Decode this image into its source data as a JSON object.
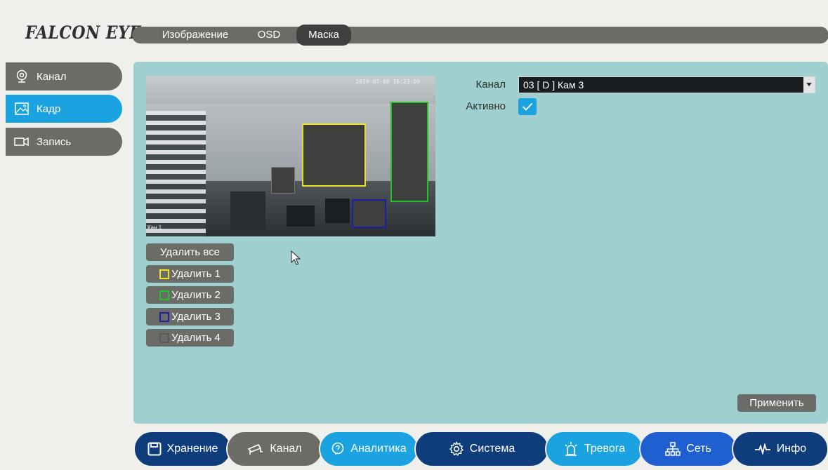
{
  "brand": {
    "logo": "FALCON EYE"
  },
  "tabs": [
    {
      "label": "Изображение",
      "active": false
    },
    {
      "label": "OSD",
      "active": false
    },
    {
      "label": "Маска",
      "active": true
    }
  ],
  "sidebar": {
    "items": [
      {
        "label": "Канал",
        "icon": "webcam-icon",
        "active": false
      },
      {
        "label": "Кадр",
        "icon": "image-icon",
        "active": true
      },
      {
        "label": "Запись",
        "icon": "video-camera-icon",
        "active": false
      }
    ]
  },
  "preview": {
    "timestamp": "2019-07-08 16:23:09",
    "camera_label": "Кан 1",
    "masks": [
      {
        "id": 1,
        "color": "#e8e22a"
      },
      {
        "id": 2,
        "color": "#22c22a"
      },
      {
        "id": 3,
        "color": "#1a1fa8"
      }
    ]
  },
  "delete": {
    "all_label": "Удалить все",
    "buttons": [
      {
        "label": "Удалить 1",
        "color": "#f1e51f"
      },
      {
        "label": "Удалить 2",
        "color": "#22c22a"
      },
      {
        "label": "Удалить 3",
        "color": "#1a1fa8"
      },
      {
        "label": "Удалить 4",
        "color": "#5a5b58"
      }
    ]
  },
  "form": {
    "channel_label": "Канал",
    "channel_value": "03 [ D ] Кам 3",
    "active_label": "Активно",
    "active_checked": true,
    "apply_label": "Применить"
  },
  "bottom_nav": [
    {
      "label": "Хранение",
      "icon": "floppy-disk-icon",
      "color": "#0f3d7c"
    },
    {
      "label": "Канал",
      "icon": "cctv-camera-icon",
      "color": "#6b6c68"
    },
    {
      "label": "Аналитика",
      "icon": "head-analytics-icon",
      "color": "#1aa3e0"
    },
    {
      "label": "Система",
      "icon": "gear-icon",
      "color": "#0f3d7c"
    },
    {
      "label": "Тревога",
      "icon": "alarm-light-icon",
      "color": "#1aa3e0"
    },
    {
      "label": "Сеть",
      "icon": "network-icon",
      "color": "#1f5fd0"
    },
    {
      "label": "Инфо",
      "icon": "pulse-icon",
      "color": "#0f3d7c"
    }
  ],
  "colors": {
    "accent": "#1aa3e0",
    "panel": "#9fcfce",
    "button_gray": "#6b6c68",
    "navy": "#0f3d7c"
  }
}
